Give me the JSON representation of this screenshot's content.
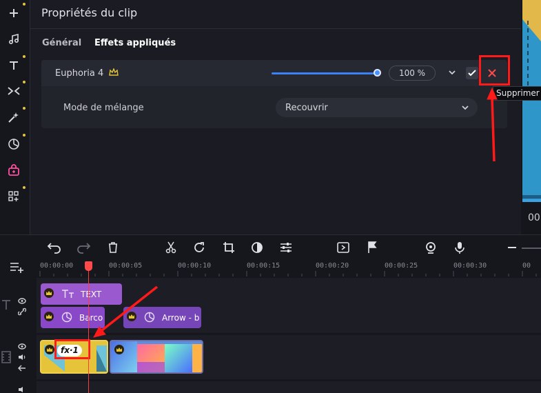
{
  "properties": {
    "title": "Propriétés du clip",
    "tabs": [
      {
        "label": "Général",
        "active": false
      },
      {
        "label": "Effets appliqués",
        "active": true
      }
    ],
    "effect": {
      "name": "Euphoria 4",
      "intensity_percent": 100,
      "intensity_label": "100 %",
      "blend_label": "Mode de mélange",
      "blend_value": "Recouvrir"
    },
    "tooltip": "Supprimer"
  },
  "preview": {
    "time_partial": "00"
  },
  "timeline": {
    "ruler_ticks": [
      "00:00:00",
      "00:00:05",
      "00:00:10",
      "00:00:15",
      "00:00:20",
      "00:00:25",
      "00:00:30",
      "00"
    ],
    "clips": {
      "text_clip": "TEXT",
      "sticker_clip_1": "Barco",
      "sticker_clip_2": "Arrow - b",
      "fx_badge": "fx·1"
    }
  },
  "colors": {
    "accent_blue": "#3b82f6",
    "delete_red": "#ff4a4a",
    "premium_gold": "#e6c43a",
    "text_clip_purple": "#9b59d0",
    "highlight_red": "#ff1a1a"
  }
}
